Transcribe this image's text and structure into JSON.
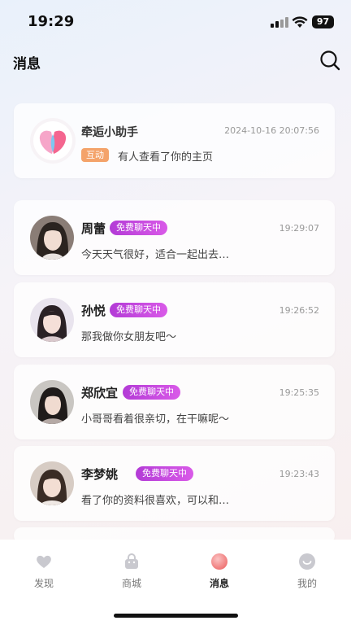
{
  "status_bar": {
    "time": "19:29",
    "battery": "97"
  },
  "header": {
    "title": "消息"
  },
  "assistant": {
    "name": "牵逅小助手",
    "timestamp": "2024-10-16 20:07:56",
    "tag": "互动",
    "preview": "有人查看了你的主页"
  },
  "chats": [
    {
      "name": "周蕾",
      "badge": "免费聊天中",
      "time": "19:29:07",
      "preview": "今天天气很好，适合一起出去…"
    },
    {
      "name": "孙悦",
      "badge": "免费聊天中",
      "time": "19:26:52",
      "preview": "那我做你女朋友吧～"
    },
    {
      "name": "郑欣宜",
      "badge": "免费聊天中",
      "time": "19:25:35",
      "preview": "小哥哥看着很亲切，在干嘛呢～"
    },
    {
      "name": "李梦姚",
      "badge": "免费聊天中",
      "time": "19:23:43",
      "preview": "看了你的资料很喜欢，可以和…"
    }
  ],
  "tabs": [
    {
      "label": "发现",
      "icon": "heart-icon"
    },
    {
      "label": "商城",
      "icon": "shopping-bag-icon"
    },
    {
      "label": "消息",
      "icon": "message-icon",
      "active": true
    },
    {
      "label": "我的",
      "icon": "profile-icon"
    }
  ],
  "colors": {
    "badge_gradient_start": "#b33bd6",
    "badge_gradient_end": "#d95ae8",
    "interact_tag": "#f4a36a",
    "active_tab": "#f08a8a"
  }
}
